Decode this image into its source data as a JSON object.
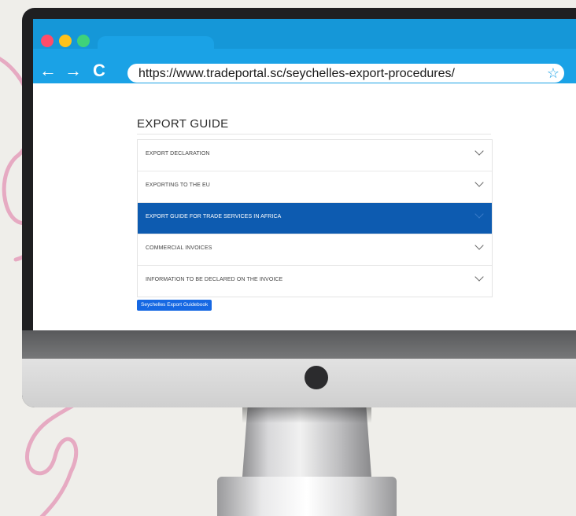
{
  "browser": {
    "url": "https://www.tradeportal.sc/seychelles-export-procedures/",
    "back_icon": "←",
    "forward_icon": "→",
    "reload_icon": "C",
    "star_icon": "☆"
  },
  "page": {
    "title": "EXPORT GUIDE",
    "accordion": [
      "EXPORT DECLARATION",
      "EXPORTING TO THE EU",
      "EXPORT GUIDE FOR TRADE SERVICES IN AFRICA",
      "COMMERCIAL INVOICES",
      "INFORMATION TO BE DECLARED ON THE INVOICE"
    ],
    "active_index": 2,
    "button_label": "Seychelles Export Guidebook"
  },
  "colors": {
    "browser_chrome": "#1aa2e6",
    "active_row": "#0d5bb0",
    "button": "#1668e3"
  }
}
